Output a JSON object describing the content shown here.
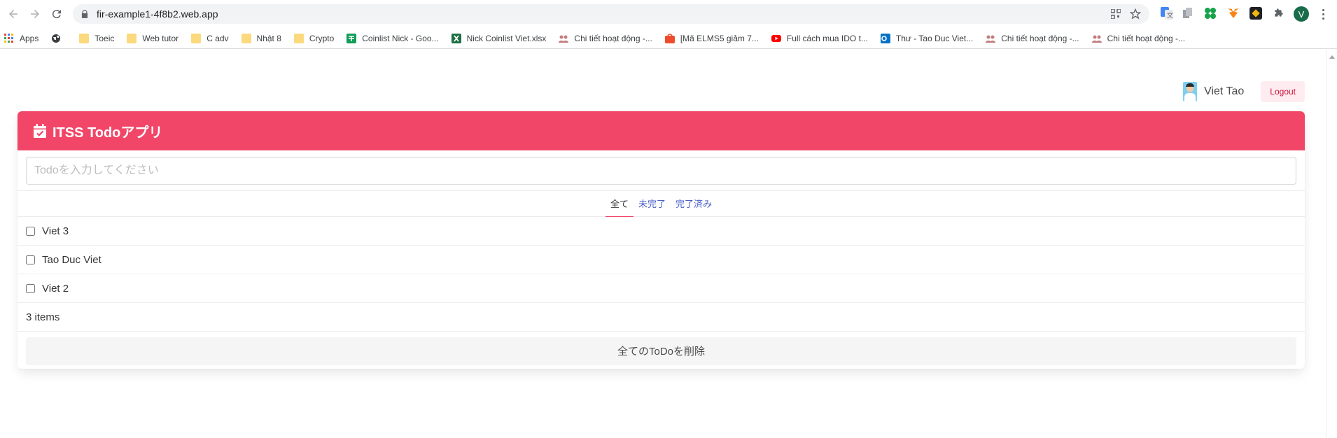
{
  "browser": {
    "url": "fir-example1-4f8b2.web.app",
    "profile_initial": "V"
  },
  "bookmarks": [
    {
      "label": "Apps",
      "icon": "apps-grid-icon"
    },
    {
      "label": "",
      "icon": "globe-icon"
    },
    {
      "label": "Toeic",
      "icon": "folder-icon"
    },
    {
      "label": "Web tutor",
      "icon": "folder-icon"
    },
    {
      "label": "C adv",
      "icon": "folder-icon"
    },
    {
      "label": "Nhật 8",
      "icon": "folder-icon"
    },
    {
      "label": "Crypto",
      "icon": "folder-icon"
    },
    {
      "label": "Coinlist Nick - Goo...",
      "icon": "sheets-icon"
    },
    {
      "label": "Nick Coinlist Viet.xlsx",
      "icon": "excel-icon"
    },
    {
      "label": "Chi tiết hoạt động -...",
      "icon": "people-icon"
    },
    {
      "label": "[Mã ELMS5 giảm 7...",
      "icon": "shopee-icon"
    },
    {
      "label": "Full cách mua IDO t...",
      "icon": "youtube-icon"
    },
    {
      "label": "Thư - Tao Duc Viet...",
      "icon": "outlook-icon"
    },
    {
      "label": "Chi tiết hoạt động -...",
      "icon": "people-icon"
    },
    {
      "label": "Chi tiết hoạt động -...",
      "icon": "people-icon"
    }
  ],
  "user": {
    "name": "Viet Tao",
    "logout_label": "Logout"
  },
  "app": {
    "title": "ITSS Todoアプリ",
    "input_placeholder": "Todoを入力してください",
    "tabs": [
      {
        "label": "全て",
        "active": true
      },
      {
        "label": "未完了",
        "active": false
      },
      {
        "label": "完了済み",
        "active": false
      }
    ],
    "items": [
      {
        "label": "Viet 3",
        "done": false
      },
      {
        "label": "Tao Duc Viet",
        "done": false
      },
      {
        "label": "Viet 2",
        "done": false
      }
    ],
    "count_label": "3 items",
    "clear_label": "全てのToDoを削除"
  },
  "colors": {
    "accent": "#f14668",
    "link": "#485fc7",
    "logout_bg": "#feecf0",
    "logout_text": "#cc0f35"
  }
}
